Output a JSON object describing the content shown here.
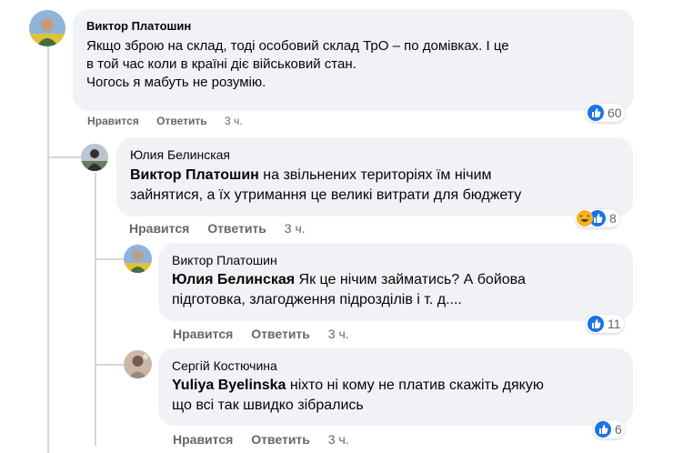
{
  "comments": [
    {
      "author": "Виктор Платошин",
      "mention": "",
      "text_lines": [
        "Якщо зброю на склад, тоді особовий склад ТрО – по домівках. І це",
        "в той час коли в країні діє військовий стан.",
        "Чогось я мабуть не розумію."
      ],
      "like_label": "Нравится",
      "reply_label": "Ответить",
      "time": "3 ч.",
      "reaction_icons": [
        "like-icon"
      ],
      "reaction_count": "60"
    },
    {
      "author": "Юлия Белинская",
      "mention": "Виктор Платошин",
      "text_lines": [
        " на звільнених територіях їм нічим",
        "зайнятися, а їх утримання це великі витрати для бюджету"
      ],
      "like_label": "Нравится",
      "reply_label": "Ответить",
      "time": "3 ч.",
      "reaction_icons": [
        "haha-icon",
        "like-icon"
      ],
      "reaction_count": "8"
    },
    {
      "author": "Виктор Платошин",
      "mention": "Юлия Белинская",
      "text_lines": [
        " Як це нічим займатись? А бойова",
        "підготовка, злагодження підрозділів і т. д...."
      ],
      "like_label": "Нравится",
      "reply_label": "Ответить",
      "time": "3 ч.",
      "reaction_icons": [
        "like-icon"
      ],
      "reaction_count": "11"
    },
    {
      "author": "Сергій Костючина",
      "mention": "Yuliya Byelinska",
      "text_lines": [
        " ніхто ні кому не платив скажіть дякую",
        "що всі так швидко зібрались"
      ],
      "like_label": "Нравится",
      "reply_label": "Ответить",
      "time": "3 ч.",
      "reaction_icons": [
        "like-icon"
      ],
      "reaction_count": "6"
    }
  ],
  "colors": {
    "bubble": "#f0f2f5",
    "secondary_text": "#65676b",
    "like_blue": "#1b74e4",
    "haha_yellow": "#f7b125"
  }
}
